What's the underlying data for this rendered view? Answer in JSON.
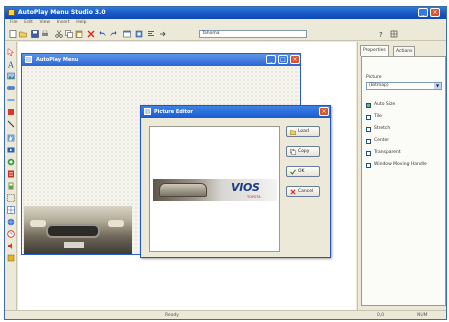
{
  "app": {
    "title": "AutoPlay Menu Studio 3.0",
    "window_buttons": [
      "_",
      "□",
      "×"
    ]
  },
  "menu": [
    "File",
    "Edit",
    "View",
    "Insert",
    "Help"
  ],
  "toolbar": {
    "tools": [
      "new-icon",
      "open-icon",
      "save-icon",
      "print-icon",
      "cut-icon",
      "copy-icon",
      "paste-icon",
      "delete-icon",
      "undo-icon",
      "redo-icon",
      "preview-icon",
      "build-icon"
    ],
    "combo_value": "Tahoma",
    "right_icons": [
      "help-icon",
      "settings-icon"
    ]
  },
  "left_tools": [
    "pointer-icon",
    "text-icon",
    "image-icon",
    "button-icon",
    "label-icon",
    "shape-icon",
    "line-icon",
    "flash-icon",
    "video-icon",
    "web-icon",
    "list-icon",
    "link-icon",
    "globe-icon",
    "timer-icon",
    "sound-icon",
    "exit-icon"
  ],
  "form_window": {
    "title": "AutoPlay Menu",
    "buttons": [
      "_",
      "□",
      "×"
    ]
  },
  "picture_editor": {
    "title": "Picture Editor",
    "close": "×",
    "banner_brand": "VIOS",
    "banner_tagline": "TOYOTA",
    "buttons": [
      {
        "label": "Load",
        "icon": "load-icon"
      },
      {
        "label": "Copy",
        "icon": "copy-icon"
      },
      {
        "label": "OK",
        "icon": "check-icon"
      },
      {
        "label": "Cancel",
        "icon": "cancel-icon"
      }
    ]
  },
  "properties": {
    "tabs": [
      "Properties",
      "Actions"
    ],
    "picture_label": "Picture",
    "picture_value": "(Bitmap)",
    "options": [
      {
        "label": "Auto Size",
        "checked": true
      },
      {
        "label": "Tile",
        "checked": false
      },
      {
        "label": "Stretch",
        "checked": false
      },
      {
        "label": "Center",
        "checked": false
      },
      {
        "label": "Transparent",
        "checked": false
      },
      {
        "label": "Window Moving Handle",
        "checked": false
      }
    ]
  },
  "status": {
    "left": "Ready",
    "middle": "0,0",
    "right": "NUM"
  }
}
